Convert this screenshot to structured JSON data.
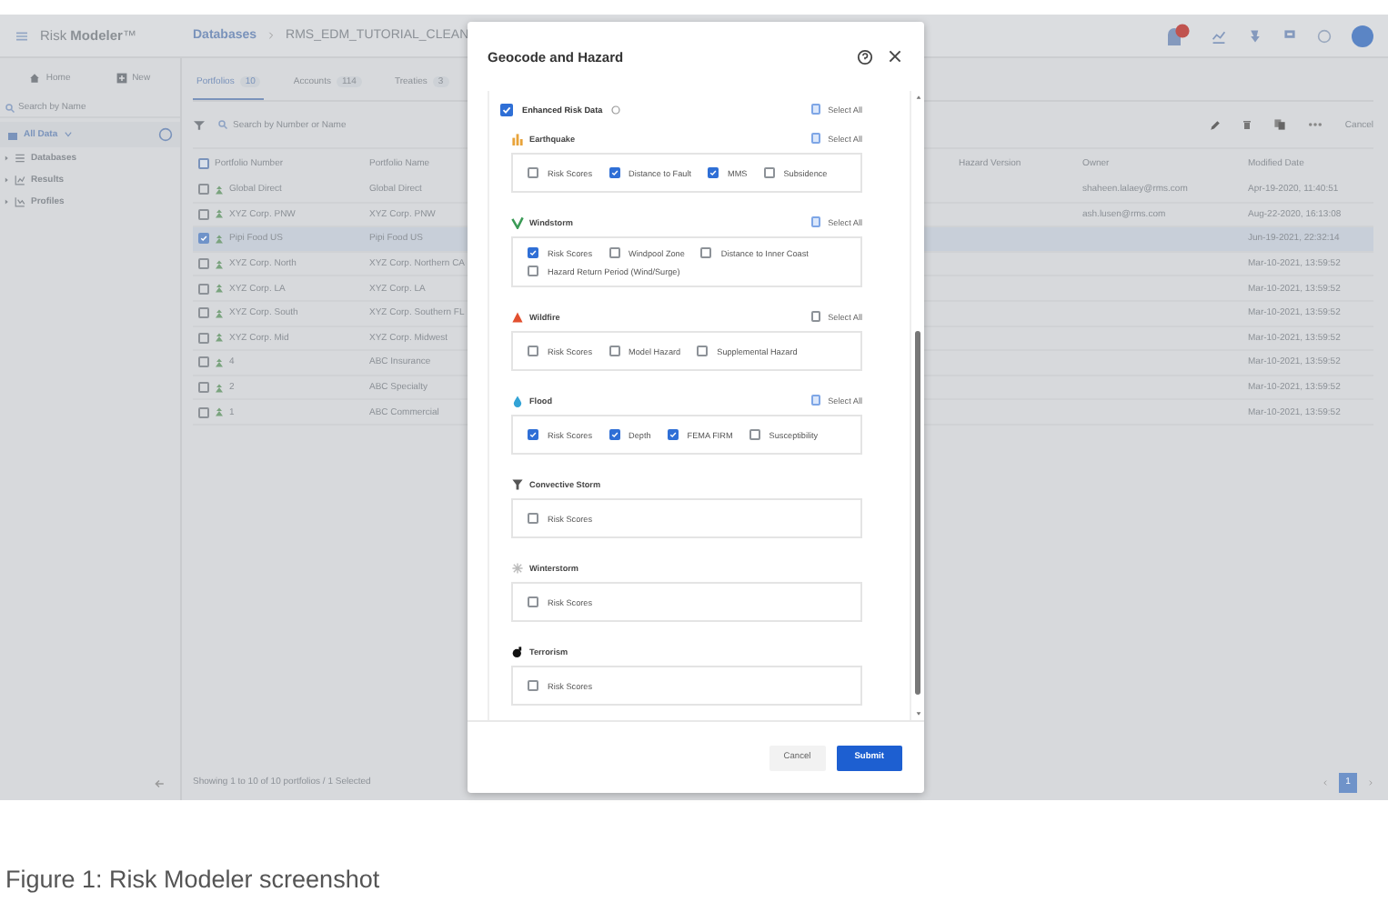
{
  "app": {
    "brand": "Risk **Modeler**™",
    "breadcrumb": [
      {
        "label": "Databases",
        "kind": "link"
      },
      {
        "label": "RMS_EDM_TUTORIAL_CLEAN",
        "kind": "current"
      }
    ]
  },
  "sidebar": {
    "buttons": [
      {
        "label": "Home",
        "kind": "home"
      },
      {
        "label": "New",
        "kind": "new"
      }
    ],
    "search": {
      "placeholder": "Search by Name"
    },
    "scope": "All Data",
    "tree": [
      {
        "label": "Databases",
        "kind": "databases",
        "expanded": false
      },
      {
        "label": "Results",
        "kind": "results",
        "expanded": false
      },
      {
        "label": "Profiles",
        "kind": "profiles",
        "expanded": false
      }
    ]
  },
  "tabs": [
    {
      "label": "Portfolios",
      "count": "10",
      "selected": true
    },
    {
      "label": "Accounts",
      "count": "114",
      "selected": false
    },
    {
      "label": "Treaties",
      "count": "3",
      "selected": false
    }
  ],
  "toolbar": {
    "search": {
      "placeholder": "Search by Number or Name"
    },
    "cancel": "Cancel"
  },
  "table": {
    "select_all_partial": true,
    "columns": [
      "Portfolio Number",
      "Portfolio Name",
      "Hazard Version",
      "Owner",
      "Modified Date"
    ],
    "rows": [
      {
        "number": "Global Direct",
        "name": "Global Direct",
        "owner": "shaheen.lalaey@rms.com",
        "modified": "Apr-19-2020, 11:40:51",
        "checked": false,
        "selected": false
      },
      {
        "number": "XYZ Corp. PNW",
        "name": "XYZ Corp. PNW",
        "owner": "ash.lusen@rms.com",
        "modified": "Aug-22-2020, 16:13:08",
        "checked": false,
        "selected": false
      },
      {
        "number": "Pipi Food US",
        "name": "Pipi Food US",
        "modified": "Jun-19-2021, 22:32:14",
        "checked": true,
        "selected": true
      },
      {
        "number": "XYZ Corp. North",
        "name": "XYZ Corp. Northern CA",
        "modified": "Mar-10-2021, 13:59:52",
        "checked": false,
        "selected": false
      },
      {
        "number": "XYZ Corp. LA",
        "name": "XYZ Corp. LA",
        "modified": "Mar-10-2021, 13:59:52",
        "checked": false,
        "selected": false
      },
      {
        "number": "XYZ Corp. South",
        "name": "XYZ Corp. Southern FL",
        "modified": "Mar-10-2021, 13:59:52",
        "checked": false,
        "selected": false
      },
      {
        "number": "XYZ Corp. Mid",
        "name": "XYZ Corp. Midwest",
        "modified": "Mar-10-2021, 13:59:52",
        "checked": false,
        "selected": false
      },
      {
        "number": "4",
        "name": "ABC Insurance",
        "modified": "Mar-10-2021, 13:59:52",
        "checked": false,
        "selected": false
      },
      {
        "number": "2",
        "name": "ABC Specialty",
        "modified": "Mar-10-2021, 13:59:52",
        "checked": false,
        "selected": false
      },
      {
        "number": "1",
        "name": "ABC Commercial",
        "modified": "Mar-10-2021, 13:59:52",
        "checked": false,
        "selected": false
      }
    ]
  },
  "footer": "Showing 1 to 10 of 10 portfolios / 1 Selected",
  "pagination": [
    {
      "label": "1",
      "selected": true
    }
  ],
  "modal": {
    "title": "Geocode and Hazard",
    "enhanced": {
      "label": "Enhanced Risk Data",
      "checked": true,
      "select_all": {
        "label": "Select All",
        "partial": true
      }
    },
    "sections": [
      {
        "kind": "earthquake",
        "name": "Earthquake",
        "select_all": {
          "label": "Select All",
          "partial": true
        },
        "options": [
          {
            "label": "Risk Scores",
            "checked": false
          },
          {
            "label": "Distance to Fault",
            "checked": true
          },
          {
            "label": "MMS",
            "checked": true
          },
          {
            "label": "Subsidence",
            "checked": false
          }
        ]
      },
      {
        "kind": "windstorm",
        "name": "Windstorm",
        "select_all": {
          "label": "Select All",
          "partial": true
        },
        "options": [
          {
            "label": "Risk Scores",
            "checked": true
          },
          {
            "label": "Windpool Zone",
            "checked": false
          },
          {
            "label": "Distance to Inner Coast",
            "checked": false
          },
          {
            "label": "Hazard Return Period (Wind/Surge)",
            "checked": false
          }
        ]
      },
      {
        "kind": "wildfire",
        "name": "Wildfire",
        "select_all": {
          "label": "Select All",
          "partial": false
        },
        "options": [
          {
            "label": "Risk Scores",
            "checked": false
          },
          {
            "label": "Model Hazard",
            "checked": false
          },
          {
            "label": "Supplemental Hazard",
            "checked": false
          }
        ]
      },
      {
        "kind": "flood",
        "name": "Flood",
        "select_all": {
          "label": "Select All",
          "partial": true
        },
        "options": [
          {
            "label": "Risk Scores",
            "checked": true
          },
          {
            "label": "Depth",
            "checked": true
          },
          {
            "label": "FEMA FIRM",
            "checked": true
          },
          {
            "label": "Susceptibility",
            "checked": false
          }
        ]
      },
      {
        "kind": "convective",
        "name": "Convective Storm",
        "options": [
          {
            "label": "Risk Scores",
            "checked": false
          }
        ]
      },
      {
        "kind": "winter",
        "name": "Winterstorm",
        "options": [
          {
            "label": "Risk Scores",
            "checked": false
          }
        ]
      },
      {
        "kind": "terrorism",
        "name": "Terrorism",
        "options": [
          {
            "label": "Risk Scores",
            "checked": false
          }
        ]
      }
    ],
    "buttons": [
      {
        "label": "Cancel",
        "kind": "secondary"
      },
      {
        "label": "Submit",
        "kind": "primary"
      }
    ]
  },
  "caption": "Figure 1: Risk Modeler screenshot"
}
